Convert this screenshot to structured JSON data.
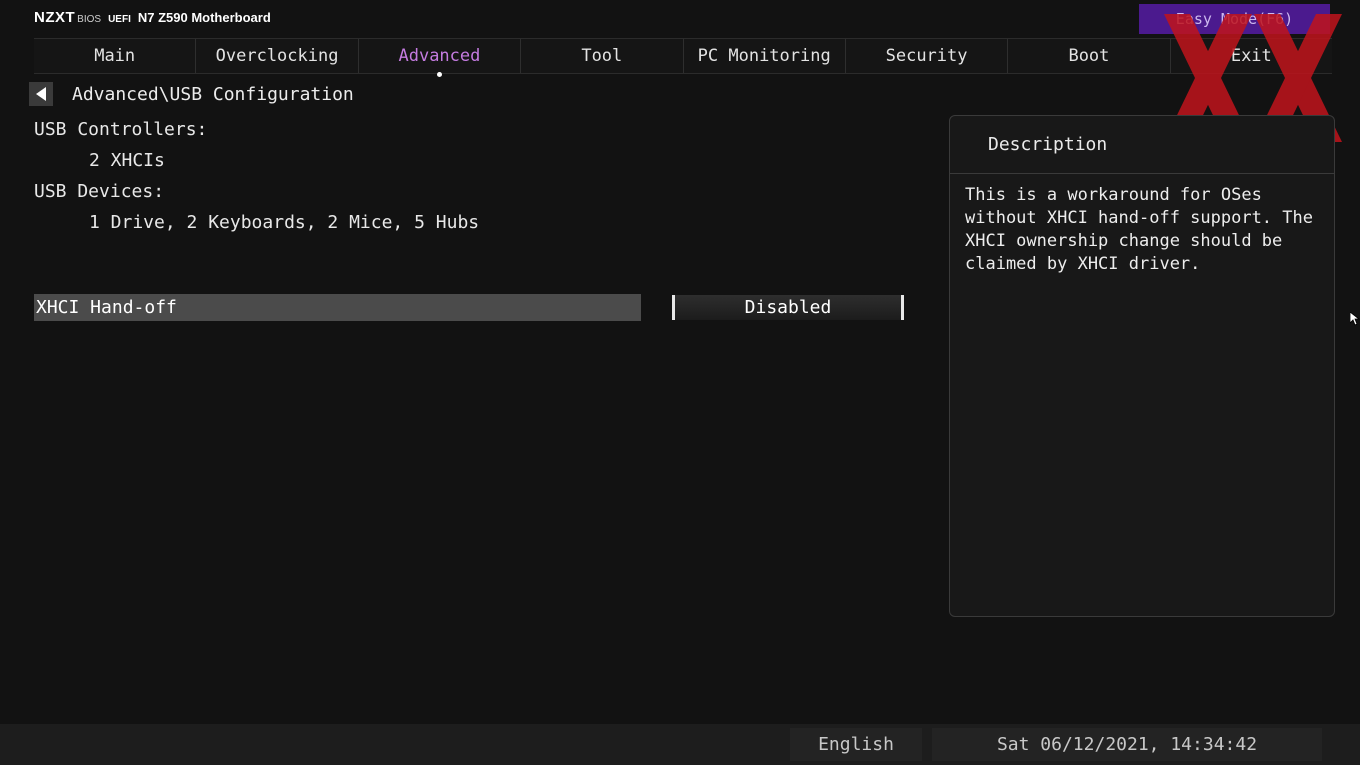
{
  "header": {
    "brand_logo": "NZXT",
    "brand_bios": "BIOS",
    "brand_uefi": "UEFI",
    "model": "N7 Z590 Motherboard",
    "easy_mode_label": "Easy Mode(F6)"
  },
  "tabs": [
    {
      "label": "Main",
      "active": false
    },
    {
      "label": "Overclocking",
      "active": false
    },
    {
      "label": "Advanced",
      "active": true
    },
    {
      "label": "Tool",
      "active": false
    },
    {
      "label": "PC Monitoring",
      "active": false
    },
    {
      "label": "Security",
      "active": false
    },
    {
      "label": "Boot",
      "active": false
    },
    {
      "label": "Exit",
      "active": false
    }
  ],
  "breadcrumb": "Advanced\\USB Configuration",
  "info": {
    "controllers_label": "USB Controllers:",
    "controllers_value": "2 XHCIs",
    "devices_label": "USB Devices:",
    "devices_value": "1 Drive, 2 Keyboards, 2 Mice, 5 Hubs"
  },
  "setting": {
    "label": "XHCI Hand-off",
    "value": "Disabled"
  },
  "description": {
    "title": "Description",
    "text": "This is a workaround for OSes without XHCI hand-off support. The XHCI ownership change should be claimed by XHCI driver."
  },
  "footer": {
    "language": "English",
    "datetime": "Sat 06/12/2021, 14:34:42"
  },
  "colors": {
    "accent_tab": "#c47be0",
    "easy_mode_bg": "#4b1a8e",
    "watermark": "#c0141c"
  },
  "icons": {
    "back": "triangle-left-icon",
    "watermark": "xx-watermark-icon",
    "cursor": "mouse-pointer-icon"
  }
}
